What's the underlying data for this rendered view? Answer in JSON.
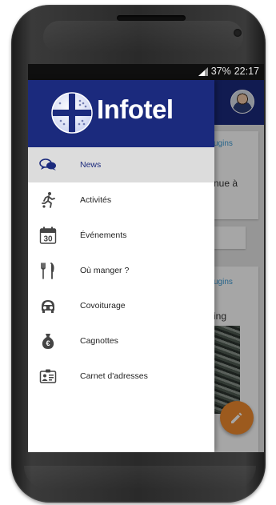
{
  "status": {
    "battery": "37%",
    "time": "22:17"
  },
  "brand": {
    "name": "Infotel"
  },
  "background_cards": [
    {
      "link": "ugins",
      "text": "nue à"
    },
    {
      "link": "ugins",
      "text": "ing"
    }
  ],
  "menu": {
    "items": [
      {
        "label": "News",
        "icon": "chat-bubbles-icon",
        "active": true
      },
      {
        "label": "Activités",
        "icon": "runner-icon",
        "active": false
      },
      {
        "label": "Événements",
        "icon": "calendar-icon",
        "active": false
      },
      {
        "label": "Où manger ?",
        "icon": "fork-knife-icon",
        "active": false
      },
      {
        "label": "Covoiturage",
        "icon": "car-icon",
        "active": false
      },
      {
        "label": "Cagnottes",
        "icon": "money-bag-icon",
        "active": false
      },
      {
        "label": "Carnet d'adresses",
        "icon": "address-card-icon",
        "active": false
      }
    ]
  },
  "calendar_icon_day": "30",
  "colors": {
    "primary": "#1b2a7d",
    "active_item_bg": "#dcdcdc",
    "fab": "#f08a2e",
    "link": "#3d9bd6"
  }
}
